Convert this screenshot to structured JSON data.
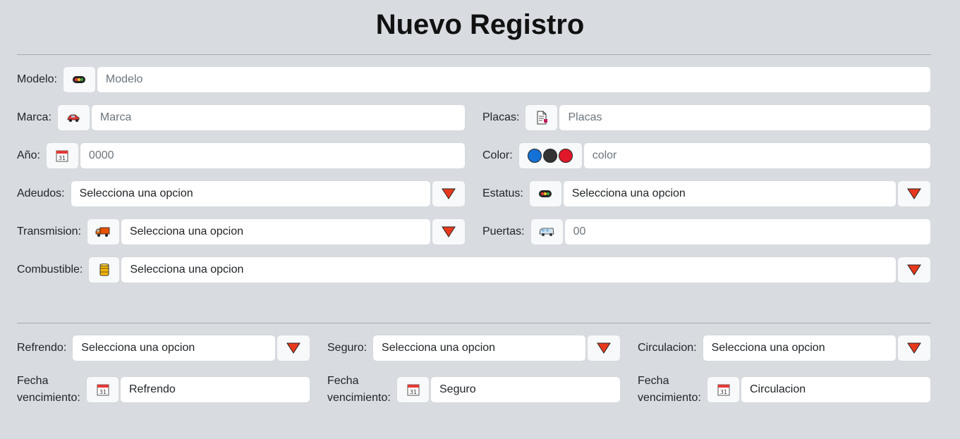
{
  "title": "Nuevo Registro",
  "fields": {
    "modelo": {
      "label": "Modelo:",
      "placeholder": "Modelo",
      "icon": "traffic-light-icon"
    },
    "marca": {
      "label": "Marca:",
      "placeholder": "Marca",
      "icon": "car-icon"
    },
    "placas": {
      "label": "Placas:",
      "placeholder": "Placas",
      "icon": "document-icon"
    },
    "anio": {
      "label": "Año:",
      "placeholder": "0000",
      "icon": "calendar-icon"
    },
    "color": {
      "label": "Color:",
      "placeholder": "color",
      "icon": "color-dots-icon",
      "dot_colors": [
        "#1571d6",
        "#333333",
        "#e0182a"
      ]
    },
    "adeudos": {
      "label": "Adeudos:",
      "value": "Selecciona una opcion"
    },
    "estatus": {
      "label": "Estatus:",
      "value": "Selecciona una opcion",
      "icon": "traffic-light-icon"
    },
    "transmision": {
      "label": "Transmision:",
      "value": "Selecciona una opcion",
      "icon": "truck-icon"
    },
    "puertas": {
      "label": "Puertas:",
      "placeholder": "00",
      "icon": "van-icon"
    },
    "combustible": {
      "label": "Combustible:",
      "value": "Selecciona una opcion",
      "icon": "oil-drum-icon"
    }
  },
  "documents": {
    "refrendo": {
      "label": "Refrendo:",
      "value": "Selecciona una opcion",
      "date_label": "Fecha vencimiento:",
      "date_value": "Refrendo"
    },
    "seguro": {
      "label": "Seguro:",
      "value": "Selecciona una opcion",
      "date_label": "Fecha vencimiento:",
      "date_value": "Seguro"
    },
    "circulacion": {
      "label": "Circulacion:",
      "value": "Selecciona una opcion",
      "date_label": "Fecha vencimiento:",
      "date_value": "Circulacion"
    }
  },
  "calendar_day": "31",
  "colors": {
    "caret": "#e8391d",
    "background": "#d8dce1"
  }
}
